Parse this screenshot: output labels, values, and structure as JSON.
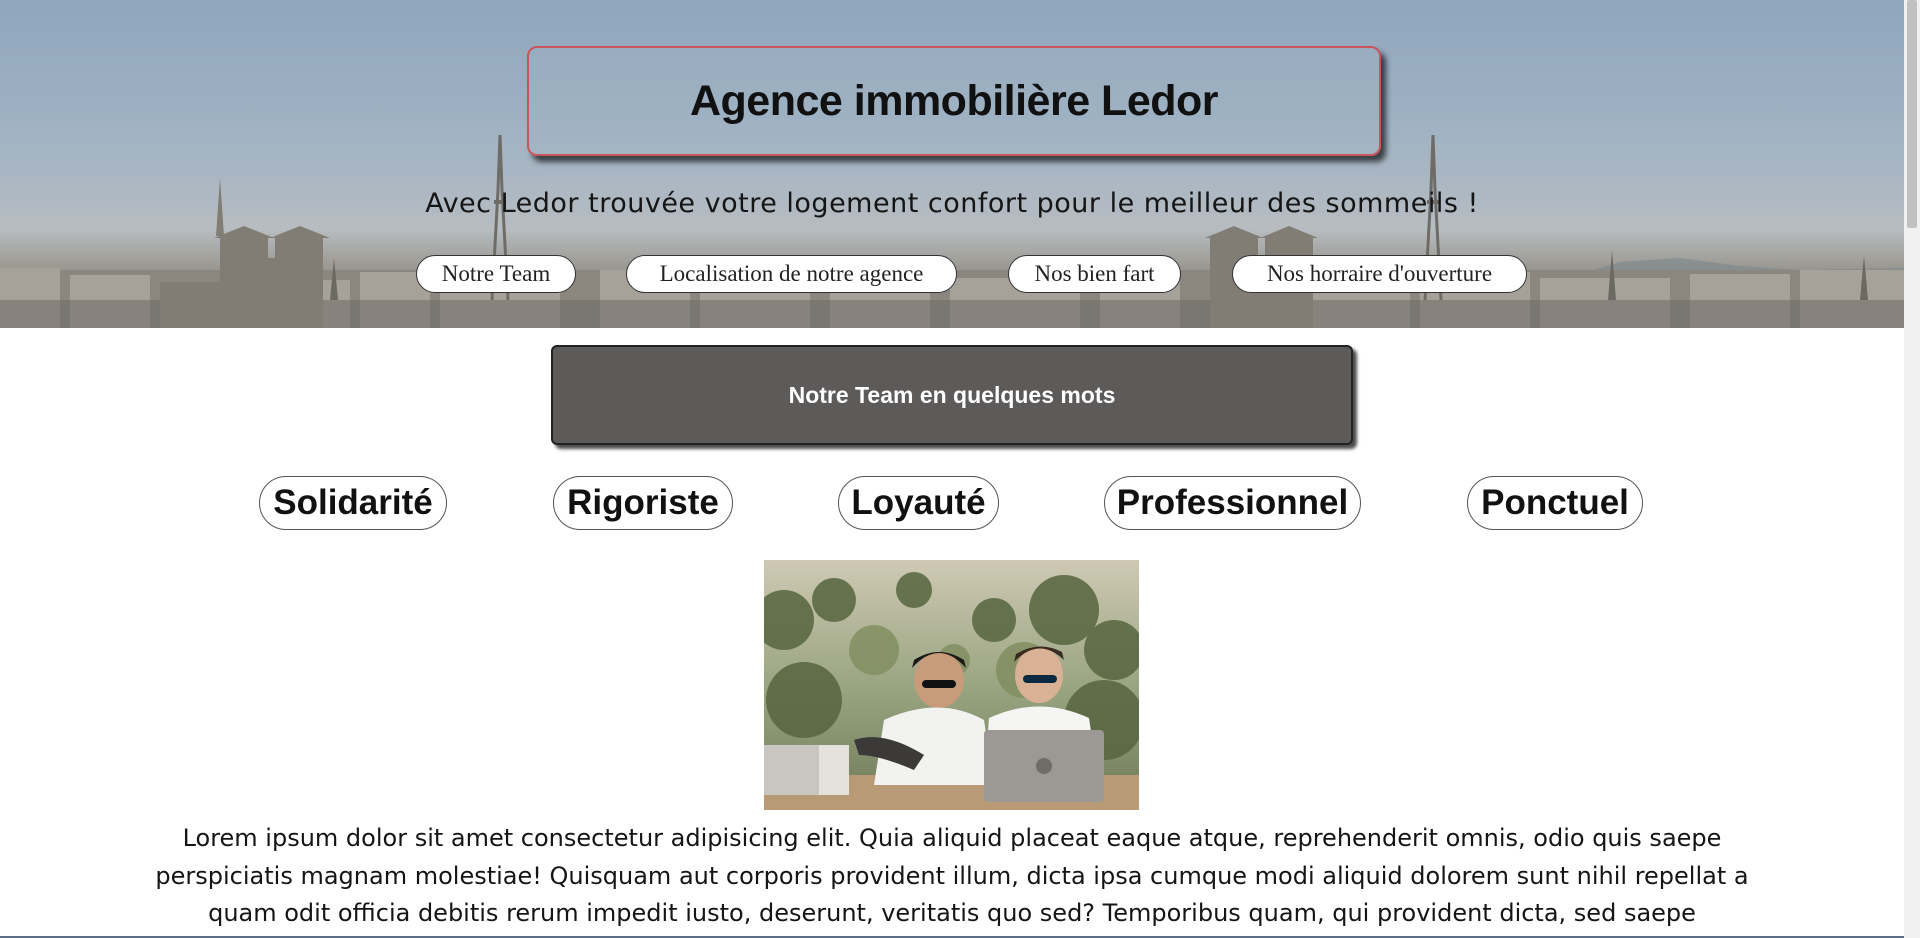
{
  "header": {
    "title": "Agence immobilière Ledor",
    "tagline": "Avec Ledor trouvée votre logement confort pour le meilleur des sommeils !"
  },
  "nav": {
    "items": [
      {
        "label": "Notre Team"
      },
      {
        "label": "Localisation de notre agence"
      },
      {
        "label": "Nos bien fart"
      },
      {
        "label": "Nos horraire d'ouverture"
      }
    ]
  },
  "team_section": {
    "heading": "Notre Team en quelques mots",
    "values": [
      "Solidarité",
      "Rigoriste",
      "Loyauté",
      "Professionnel",
      "Ponctuel"
    ],
    "photo_icon": "team-photo",
    "body": "Lorem ipsum dolor sit amet consectetur adipisicing elit. Quia aliquid placeat eaque atque, reprehenderit omnis, odio quis saepe perspiciatis magnam molestiae! Quisquam aut corporis provident illum, dicta ipsa cumque modi aliquid dolorem sunt nihil repellat a quam odit officia debitis rerum impedit iusto, deserunt, veritatis quo sed? Temporibus quam, qui provident dicta, sed saepe"
  },
  "colors": {
    "title_border": "#c8555a",
    "section_box_bg": "#5d5a5a",
    "section_box_text": "#ffffff",
    "pill_border": "#333333"
  }
}
